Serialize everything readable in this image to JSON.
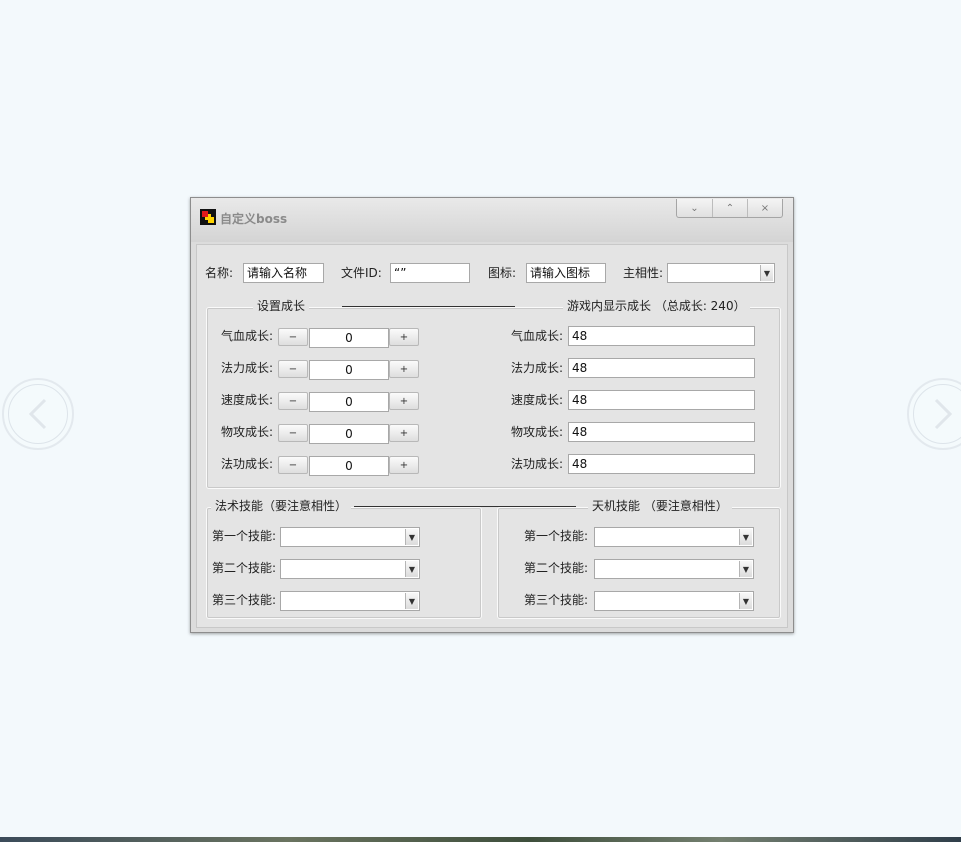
{
  "window": {
    "title": "自定义boss",
    "controls": {
      "minimize": "⌄",
      "maximize": "⌃",
      "close": "×"
    }
  },
  "header": {
    "name_label": "名称:",
    "name_value": "请输入名称",
    "file_id_label": "文件ID:",
    "file_id_value": "“”",
    "icon_label": "图标:",
    "icon_value": "请输入图标",
    "main_attr_label": "主相性:",
    "main_attr_value": ""
  },
  "growth": {
    "title": "设置成长",
    "display_title": "游戏内显示成长 （总成长: 240）",
    "minus": "−",
    "plus": "+",
    "rows": [
      {
        "label": "气血成长:",
        "value": "0",
        "display_label": "气血成长:",
        "display_value": "48"
      },
      {
        "label": "法力成长:",
        "value": "0",
        "display_label": "法力成长:",
        "display_value": "48"
      },
      {
        "label": "速度成长:",
        "value": "0",
        "display_label": "速度成长:",
        "display_value": "48"
      },
      {
        "label": "物攻成长:",
        "value": "0",
        "display_label": "物攻成长:",
        "display_value": "48"
      },
      {
        "label": "法功成长:",
        "value": "0",
        "display_label": "法功成长:",
        "display_value": "48"
      }
    ]
  },
  "skills": {
    "magic_title": "法术技能（要注意相性）",
    "tianji_title": "天机技能 （要注意相性）",
    "magic": [
      {
        "label": "第一个技能:",
        "value": ""
      },
      {
        "label": "第二个技能:",
        "value": ""
      },
      {
        "label": "第三个技能:",
        "value": ""
      }
    ],
    "tianji": [
      {
        "label": "第一个技能:",
        "value": ""
      },
      {
        "label": "第二个技能:",
        "value": ""
      },
      {
        "label": "第三个技能:",
        "value": ""
      }
    ]
  },
  "icons": {
    "app": "app-logo-icon",
    "prev": "chevron-left-icon",
    "next": "chevron-right-icon",
    "dropdown": "dropdown-arrow-icon"
  }
}
